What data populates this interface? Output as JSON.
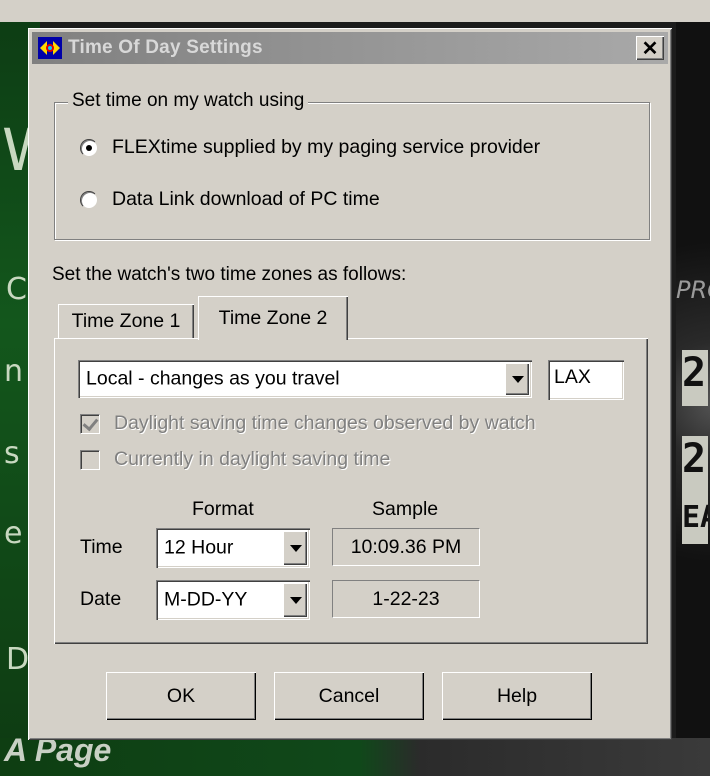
{
  "background": {
    "left_letters": [
      "W",
      "C",
      "n",
      "s",
      "e",
      "D"
    ],
    "right_label": "PRO",
    "right_digits": [
      "2",
      "2"
    ],
    "right_text": "EA",
    "bottom_text": "A Page"
  },
  "dialog": {
    "title": "Time Of Day Settings",
    "close_label": "✕",
    "time_source": {
      "legend": "Set time on my watch using",
      "options": [
        {
          "label": "FLEXtime supplied by my paging service provider",
          "selected": true
        },
        {
          "label": "Data Link download of PC time",
          "selected": false
        }
      ]
    },
    "zones_caption": "Set the watch's two time zones as follows:",
    "tabs": [
      {
        "label": "Time Zone 1",
        "active": false
      },
      {
        "label": "Time Zone 2",
        "active": true
      }
    ],
    "zone_panel": {
      "zone_select_value": "Local - changes as you travel",
      "zone_code": "LAX",
      "dst_observed": {
        "label": "Daylight saving time changes observed by watch",
        "checked": true,
        "disabled": true
      },
      "in_dst": {
        "label": "Currently in daylight saving time",
        "checked": false,
        "disabled": true
      },
      "format_header": "Format",
      "sample_header": "Sample",
      "time_label": "Time",
      "time_format": "12 Hour",
      "time_sample": "10:09.36 PM",
      "date_label": "Date",
      "date_format": "M-DD-YY",
      "date_sample": "1-22-23"
    },
    "buttons": {
      "ok": "OK",
      "cancel": "Cancel",
      "help": "Help"
    }
  }
}
